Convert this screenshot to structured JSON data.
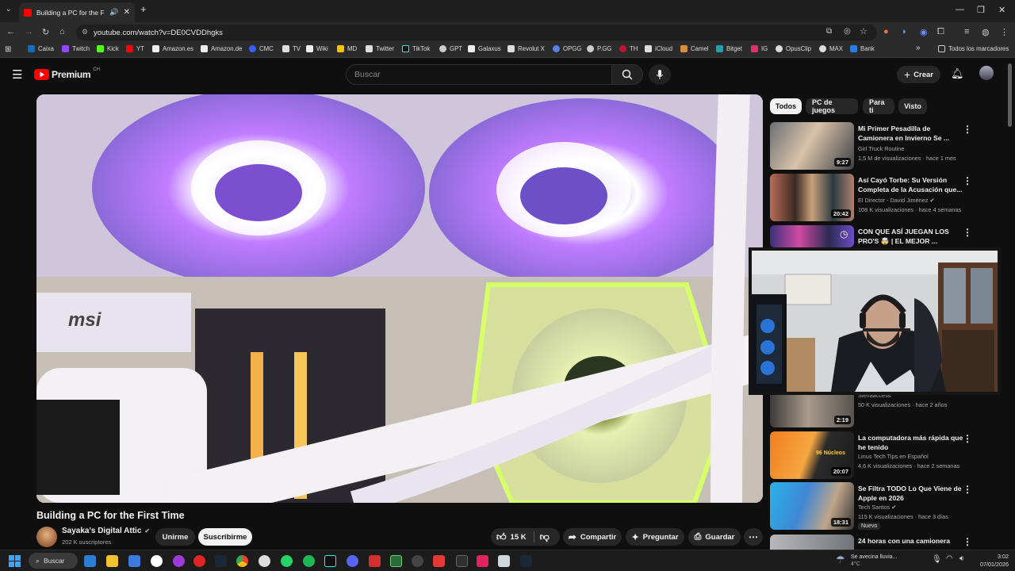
{
  "browser": {
    "tab_title": "Building a PC for the First Time",
    "url": "youtube.com/watch?v=DE0CVDDhgks",
    "bookmarks": [
      "Caixa",
      "Twitch",
      "Kick",
      "YT",
      "Amazon.es",
      "Amazon.de",
      "CMC",
      "TV",
      "Wiki",
      "MD",
      "Twitter",
      "TikTok",
      "GPT",
      "Galaxus",
      "Revolut X",
      "OPGG",
      "P.GG",
      "TH",
      "iCloud",
      "Camel",
      "Bitget",
      "IG",
      "OpusClip",
      "MAX",
      "Bank"
    ],
    "all_bookmarks": "Todos los marcadores"
  },
  "youtube": {
    "logo": "Premium",
    "region": "CH",
    "search_placeholder": "Buscar",
    "create_label": "Crear"
  },
  "video": {
    "title": "Building a PC for the First Time",
    "channel": "Sayaka's Digital Attic",
    "subscribers": "202 K suscriptores",
    "join_label": "Unirme",
    "subscribe_label": "Suscribirme",
    "likes": "15 K",
    "share_label": "Compartir",
    "ask_label": "Preguntar",
    "save_label": "Guardar",
    "overlay_text": "msi"
  },
  "chips": [
    "Todos",
    "PC de juegos",
    "Para ti",
    "Visto"
  ],
  "recommendations": [
    {
      "title": "Mi Primer Pesadilla de Camionera en Invierno Se ...",
      "channel": "Girl Truck Routine",
      "meta": "1,5 M de visualizaciones · hace 1 mes",
      "duration": "9:27"
    },
    {
      "title": "Así Cayó Torbe: Su Versión Completa de la Acusación que...",
      "channel": "El Director - David Jiménez",
      "meta": "108 K visualizaciones · hace 4 semanas",
      "duration": "20:42"
    },
    {
      "title": "CON QUE ASÍ JUEGAN LOS PRO'S 🤯 | EL MEJOR ...",
      "channel": "",
      "meta": "",
      "duration": ""
    },
    {
      "title": "",
      "channel": "Sienaaccess",
      "meta": "50 K visualizaciones · hace 2 años",
      "duration": "2:19"
    },
    {
      "title": "La computadora más rápida que he tenido",
      "channel": "Linus Tech Tips en Español",
      "meta": "4,6 K visualizaciones · hace 2 semanas",
      "duration": "20:07",
      "thumb_text": "96 Núcleos"
    },
    {
      "title": "Se Filtra TODO Lo Que Viene de Apple en 2026",
      "channel": "Tech Santos",
      "meta": "115 K visualizaciones · hace 3 días",
      "duration": "18:31",
      "badge": "Nuevo"
    },
    {
      "title": "24 horas con una camionera",
      "channel": "",
      "meta": "",
      "duration": ""
    }
  ],
  "taskbar": {
    "search_label": "Buscar",
    "weather_text": "Se avecina lluvia...",
    "temperature": "4°C",
    "time": "3:02",
    "date": "07/01/2026"
  }
}
